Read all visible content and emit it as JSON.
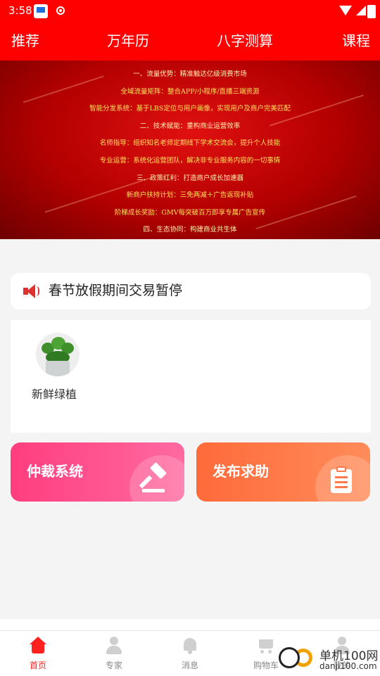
{
  "status_bar": {
    "time": "3:58"
  },
  "top_nav": {
    "tabs": [
      "推荐",
      "万年历",
      "八字测算",
      "课程"
    ]
  },
  "banner": {
    "lines": [
      "一、流量优势：精准触达亿级消费市场",
      "全域流量矩阵：整合APP/小程序/直播三端资源",
      "智能分发系统：基于LBS定位与用户画像，实现用户及商户完美匹配",
      "二、技术赋能：重构商业运营效率",
      "名师指导：组织知名老师定期线下学术交流会，提升个人技能",
      "专业运营：系统化运营团队，解决非专业服务内容的一切事情",
      "三、政策红利：打造商户成长加速器",
      "新商户扶持计划：三免两减＋广告返现补贴",
      "阶梯成长奖励：GMV每突破百万即享专属广告宣传",
      "四、生态协同：构建商业共生体"
    ]
  },
  "notice": {
    "text": "春节放假期间交易暂停",
    "icon": "speaker-icon"
  },
  "categories": [
    {
      "label": "新鲜绿植",
      "icon": "plant-avatar"
    }
  ],
  "action_cards": {
    "arbitration": {
      "label": "仲裁系统",
      "icon": "gavel-icon",
      "color": "#ff4d88"
    },
    "help": {
      "label": "发布求助",
      "icon": "clipboard-icon",
      "color": "#ff7a45"
    }
  },
  "bottom_nav": {
    "items": [
      {
        "label": "首页",
        "icon": "home-icon"
      },
      {
        "label": "专家",
        "icon": "user-icon"
      },
      {
        "label": "消息",
        "icon": "bell-icon"
      },
      {
        "label": "购物车",
        "icon": "cart-icon"
      },
      {
        "label": "我的",
        "icon": "profile-icon"
      }
    ],
    "active_color": "#ff2020"
  },
  "watermark": {
    "title": "单机100网",
    "url": "danji100.com"
  },
  "colors": {
    "brand_red": "#ff0000"
  }
}
